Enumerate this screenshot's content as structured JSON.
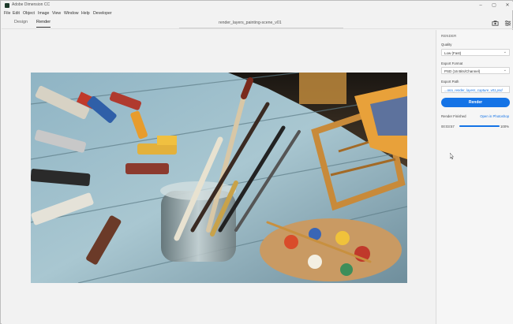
{
  "window": {
    "title": "Adobe Dimension CC",
    "controls": [
      "minimize",
      "maximize",
      "close"
    ]
  },
  "menu": [
    "File",
    "Edit",
    "Object",
    "Image",
    "View",
    "Window",
    "Help",
    "Developer"
  ],
  "tabs": [
    {
      "label": "Design",
      "active": false
    },
    {
      "label": "Render",
      "active": true
    }
  ],
  "document": {
    "title": "render_layers_painting-scene_v01"
  },
  "header_icons": [
    "render-queue-icon",
    "panel-settings-icon"
  ],
  "panel": {
    "heading": "RENDER",
    "quality": {
      "label": "Quality",
      "value": "Low (Fast)"
    },
    "export_format": {
      "label": "Export Format",
      "value": "PSD (16 Bits/Channel)"
    },
    "export_path": {
      "label": "Export Path",
      "value": "...ona_render_layers_capture_v01.psd"
    },
    "render_button": "Render",
    "finished": {
      "label": "Render Finished",
      "link": "Open in Photoshop"
    },
    "progress": {
      "time": "00:03:57",
      "percent_text": "100%",
      "fraction": 1.0
    }
  },
  "colors": {
    "accent": "#1473e6",
    "panel_bg": "#f6f6f6",
    "app_bg": "#f2f2f2"
  }
}
